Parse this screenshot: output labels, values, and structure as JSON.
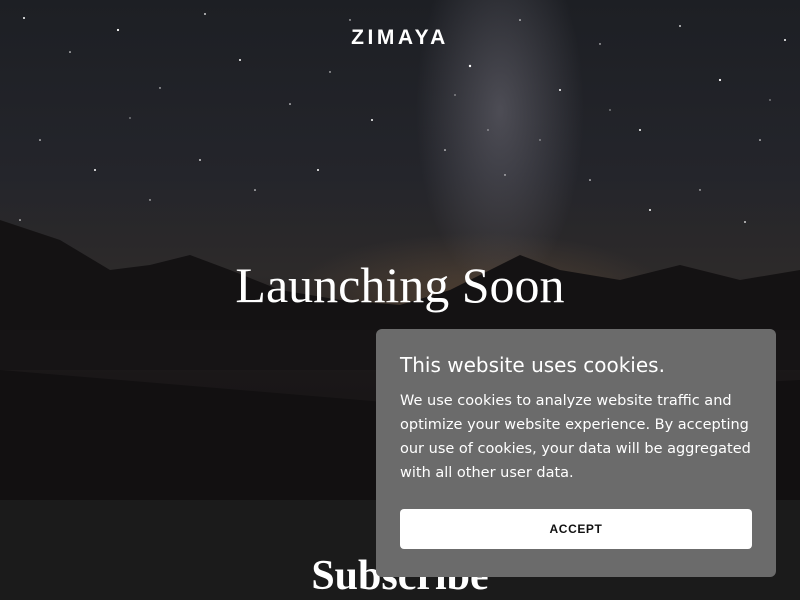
{
  "brand": {
    "name": "ZIMAYA"
  },
  "hero": {
    "headline": "Launching Soon"
  },
  "subscribe": {
    "title": "Subscribe"
  },
  "cookie_banner": {
    "title": "This website uses cookies.",
    "text": "We use cookies to analyze website traffic and optimize your website experience. By accepting our use of cookies, your data will be aggregated with all other user data.",
    "accept_label": "ACCEPT"
  },
  "colors": {
    "banner_background": "#6b6b6b",
    "button_background": "#ffffff",
    "page_background": "#1b1b1b"
  }
}
